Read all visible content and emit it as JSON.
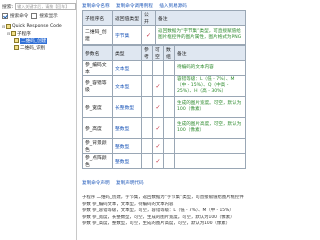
{
  "search": {
    "label": "搜索:",
    "placeholder": "输入关键字后，请按【回车】"
  },
  "filters": [
    {
      "label": "搜索命令",
      "checked": true
    },
    {
      "label": "搜索显示",
      "checked": false
    }
  ],
  "tree": [
    {
      "toggle": "-",
      "label": "子程序",
      "selected": false
    },
    {
      "toggle": "",
      "label": "二维码_创建",
      "selected": true
    },
    {
      "toggle": "",
      "label": "二维码_识别",
      "selected": false
    }
  ],
  "tree_root": "Quick Response Code",
  "links_top": [
    "复制命令名称",
    "复制命令调用例程",
    "插入到易源码"
  ],
  "sub_table": {
    "headers": [
      "子程序名",
      "返回值类型",
      "公开",
      "备注"
    ],
    "row": {
      "name": "二维码_创建",
      "ret": "字节集",
      "public": "✓",
      "note": "返回数据为“字节集”类型，可直接赋值给图片框控件的图片属性，图片格式为PNG"
    }
  },
  "param_table": {
    "headers": [
      "参数名",
      "类型",
      "参考",
      "可空",
      "数组",
      "备注"
    ],
    "rows": [
      {
        "name": "参_编码文本",
        "type": "文本型",
        "ref": "",
        "null": "",
        "arr": "",
        "note": "待编码的文本内容"
      },
      {
        "name": "参_容错等级",
        "type": "文本型",
        "ref": "",
        "null": "✓",
        "arr": "",
        "note": "容错等级：L（低 - 7%）、M（中 - 15%）、Q（中高 - 25%）、H（高 - 30%）"
      },
      {
        "name": "参_宽度",
        "type": "长整数型",
        "ref": "",
        "null": "✓",
        "arr": "",
        "note": "生成的图片宽度。可空，默认为100（像素）"
      },
      {
        "name": "参_高度",
        "type": "整数型",
        "ref": "",
        "null": "✓",
        "arr": "",
        "note": "生成的图片高度，可空，默认为100（像素）"
      },
      {
        "name": "参_背景颜色",
        "type": "整数型",
        "ref": "",
        "null": "✓",
        "arr": "",
        "note": ""
      },
      {
        "name": "参_点阵颜色",
        "type": "整数型",
        "ref": "",
        "null": "✓",
        "arr": "",
        "note": ""
      }
    ]
  },
  "links_bottom": [
    "复制命令声明",
    "复制声明代码"
  ],
  "code_lines": [
    "子程序 二维码_创建，字节集，返回数据为“字节集”类型，可直接赋值给图片框控件",
    "参数 参_编码文本，文本型，待编码的文本内容",
    "参数 参_容错等级，文本型，可空，容错等级：L（低 - 7%）、M（中 - 15%）",
    "参数 参_宽度，长整数型，可空，生成的图片宽度。可空，默认为100（像素）",
    "参数 参_高度，整数型，可空，生成的图片高度，可空，默认为100（像素）"
  ]
}
